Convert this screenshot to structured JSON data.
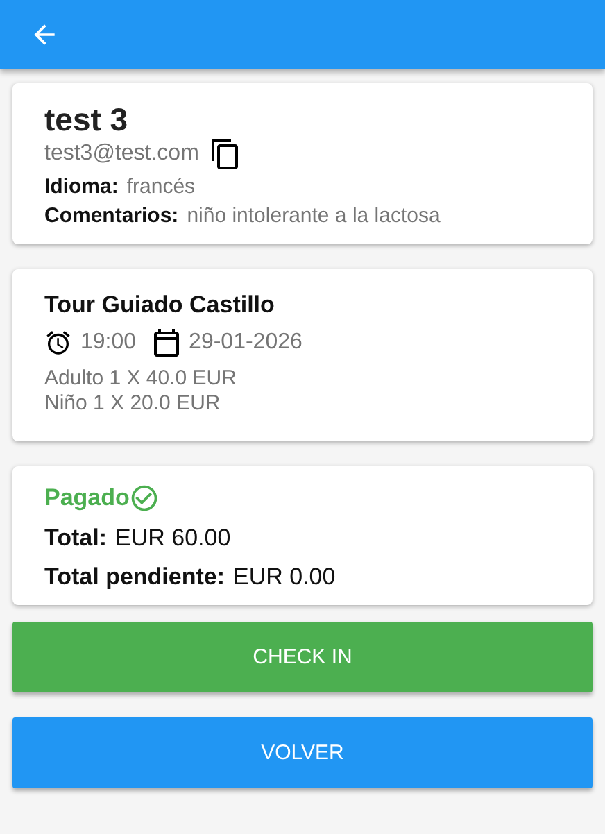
{
  "customer": {
    "name": "test 3",
    "email": "test3@test.com",
    "fields": [
      {
        "label": "Idioma:",
        "value": "francés"
      },
      {
        "label": "Comentarios:",
        "value": "niño intolerante a la lactosa"
      }
    ]
  },
  "tour": {
    "title": "Tour Guiado Castillo",
    "time": "19:00",
    "date": "29-01-2026",
    "items": [
      "Adulto 1 X 40.0 EUR",
      "Niño 1 X 20.0 EUR"
    ]
  },
  "payment": {
    "status": "Pagado",
    "paid": true,
    "totals": [
      {
        "label": "Total:",
        "value": "EUR 60.00"
      },
      {
        "label": "Total pendiente:",
        "value": "EUR 0.00"
      }
    ]
  },
  "buttons": [
    {
      "label": "CHECK IN",
      "kind": "success"
    },
    {
      "label": "VOLVER",
      "kind": "primary"
    }
  ]
}
